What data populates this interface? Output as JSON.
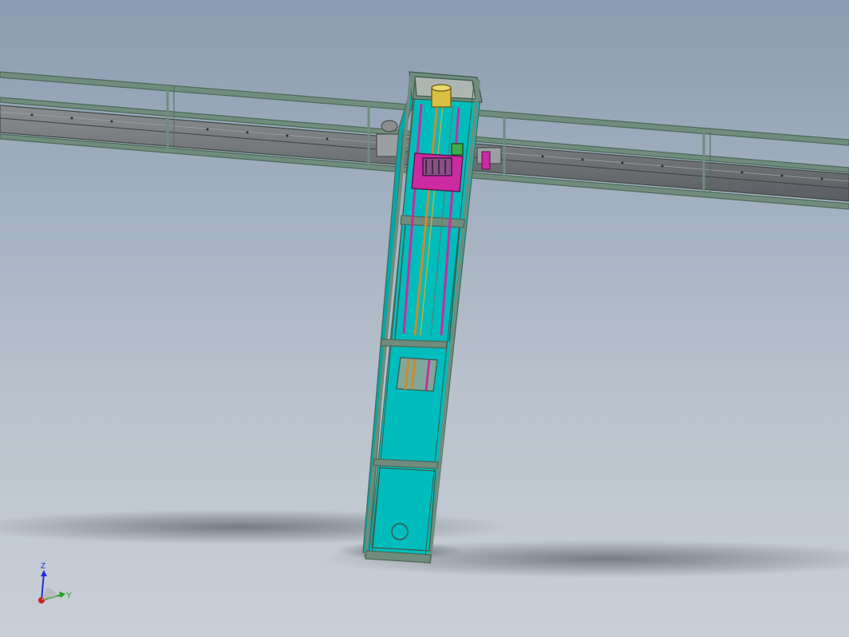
{
  "viewport": {
    "background_top": "#8a9cb1",
    "background_bottom": "#c9cfd6"
  },
  "model": {
    "frame_color": "#5e7a6a",
    "panel_color": "#00bcbc",
    "accent_magenta": "#cc2aa0",
    "accent_orange": "#d08a2a",
    "accent_yellow": "#d8c040",
    "shadow_color": "#555a60"
  },
  "triad": {
    "z_label": "Z",
    "y_label": "Y",
    "z_color": "#2030d0",
    "y_color": "#20a020",
    "x_color": "#d02020"
  }
}
